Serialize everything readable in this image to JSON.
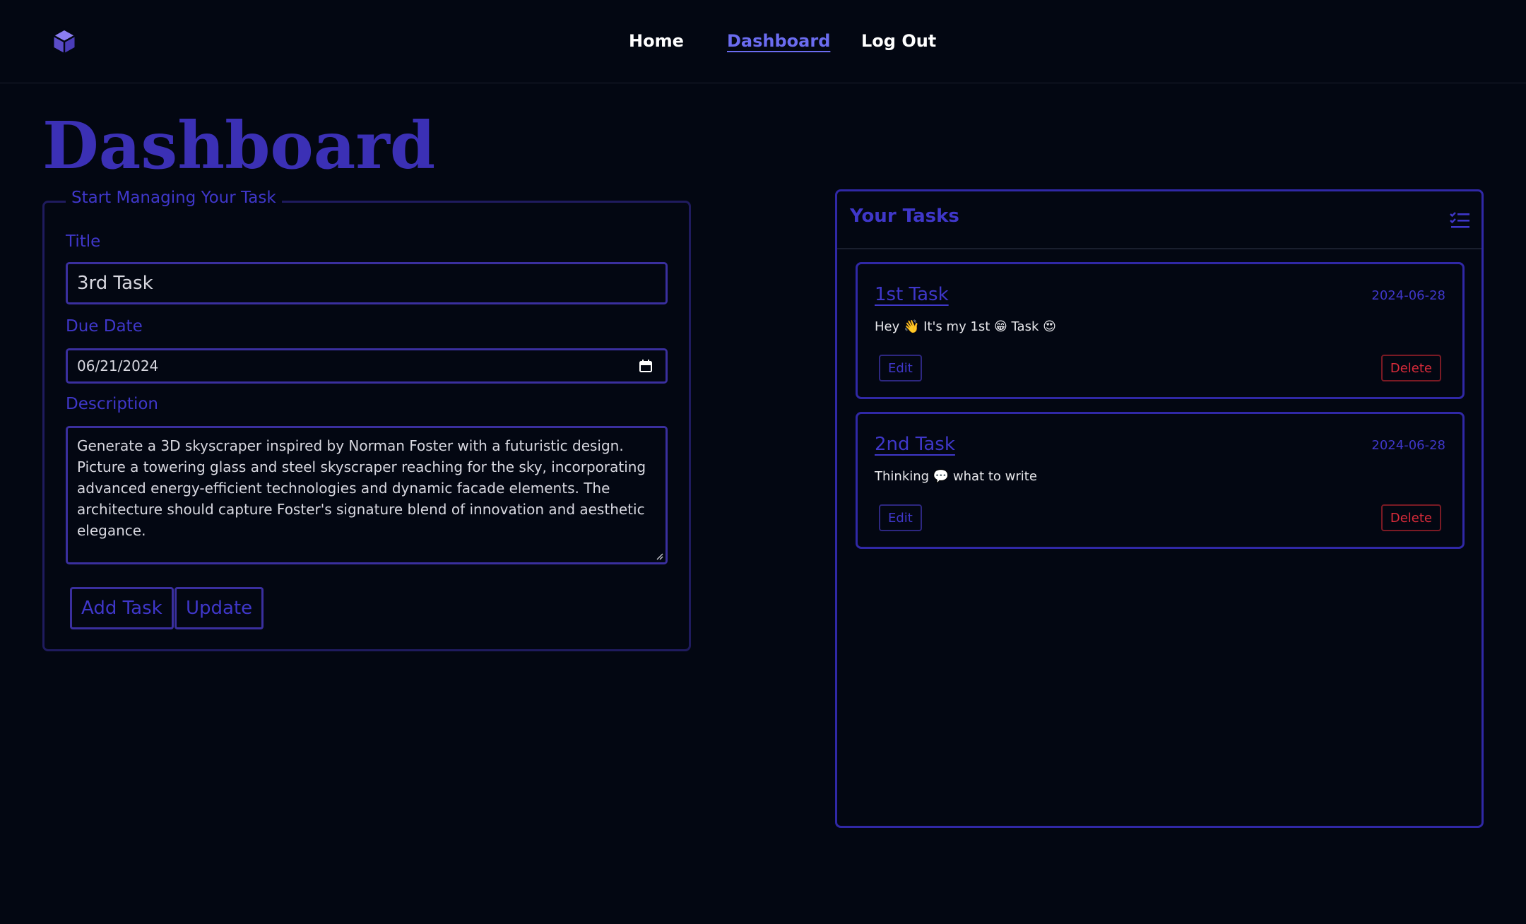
{
  "nav": {
    "logo_icon": "cube-icon",
    "links": [
      {
        "label": "Home",
        "active": false
      },
      {
        "label": "Dashboard",
        "active": true
      },
      {
        "label": "Log Out",
        "active": false
      }
    ]
  },
  "page": {
    "title": "Dashboard"
  },
  "form": {
    "legend": "Start Managing Your Task",
    "title_label": "Title",
    "title_value": "3rd Task",
    "due_label": "Due Date",
    "due_value": "06/21/2024",
    "due_icon": "calendar-icon",
    "description_label": "Description",
    "description_value": "Generate a 3D skyscraper inspired by Norman Foster with a futuristic design. Picture a towering glass and steel skyscraper reaching for the sky, incorporating advanced energy-efficient technologies and dynamic facade elements. The architecture should capture Foster's signature blend of innovation and aesthetic elegance.",
    "add_label": "Add Task",
    "update_label": "Update"
  },
  "tasks": {
    "title": "Your Tasks",
    "header_icon": "checklist-icon",
    "items": [
      {
        "name": "1st Task",
        "date": "2024-06-28",
        "description": "Hey 👋 It's my 1st 😁 Task 😍",
        "edit_label": "Edit",
        "delete_label": "Delete"
      },
      {
        "name": "2nd Task",
        "date": "2024-06-28",
        "description": "Thinking 💬 what to write",
        "edit_label": "Edit",
        "delete_label": "Delete"
      }
    ]
  },
  "colors": {
    "background": "#030712",
    "accent": "#3f37c9",
    "danger": "#d92b3a"
  }
}
